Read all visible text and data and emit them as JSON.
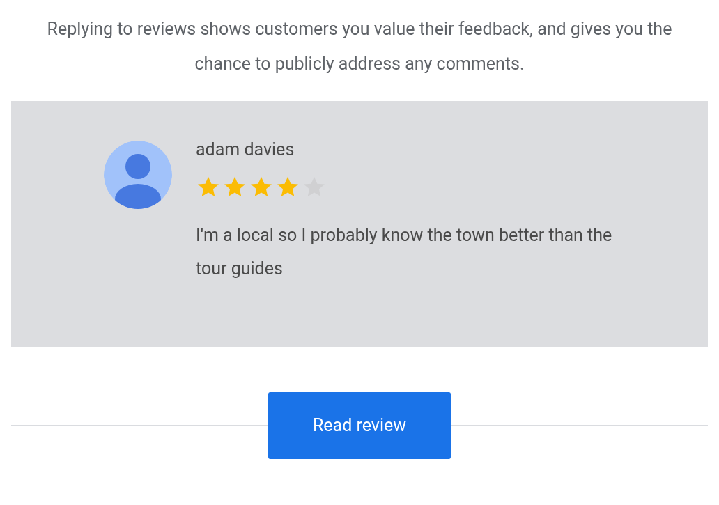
{
  "intro": "Replying to reviews shows customers you value their feedback, and gives you the chance to publicly address any comments.",
  "review": {
    "author": "adam davies",
    "stars": 4,
    "text": "I'm a local so I probably know the town better than the tour guides"
  },
  "button": "Read review"
}
